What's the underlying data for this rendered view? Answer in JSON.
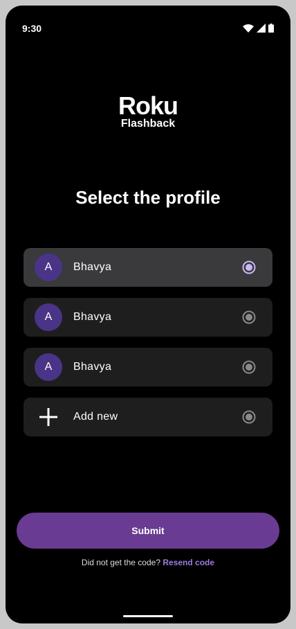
{
  "status_bar": {
    "time": "9:30",
    "icons": [
      "wifi-icon",
      "signal-icon",
      "battery-icon"
    ]
  },
  "logo": {
    "brand": "Roku",
    "product": "Flashback"
  },
  "page_title": "Select the profile",
  "profiles": [
    {
      "initial": "A",
      "name": "Bhavya",
      "selected": true
    },
    {
      "initial": "A",
      "name": "Bhavya",
      "selected": false
    },
    {
      "initial": "A",
      "name": "Bhavya",
      "selected": false
    }
  ],
  "add_new": {
    "label": "Add new",
    "icon": "plus-icon"
  },
  "submit_label": "Submit",
  "resend": {
    "prompt": "Did not get the code?",
    "link": "Resend code"
  },
  "colors": {
    "accent": "#6a3b92",
    "avatar": "#4a3487",
    "link": "#9d7be0",
    "selected_radio": "#c9b8f5"
  }
}
